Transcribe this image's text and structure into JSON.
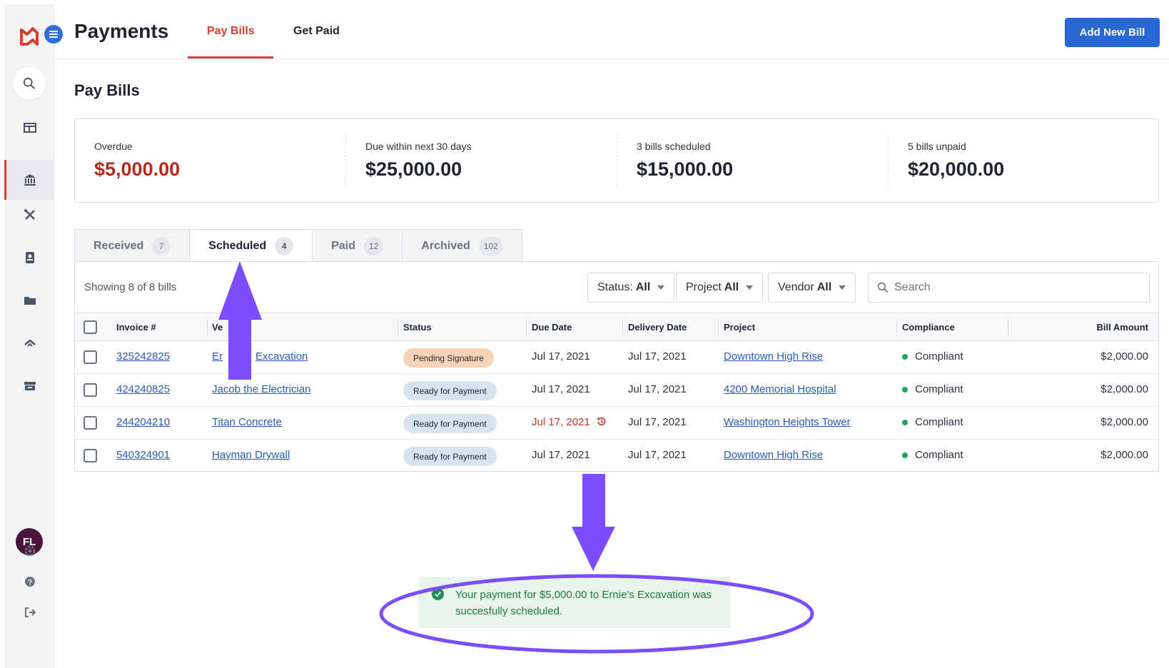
{
  "app": {
    "title": "Payments",
    "tabs": [
      "Pay Bills",
      "Get Paid"
    ],
    "add_button": "Add New Bill"
  },
  "sidebar": {
    "avatar_initials": "FL",
    "icons": [
      "search-icon",
      "dashboard-icon",
      "bank-icon",
      "tools-icon",
      "contacts-icon",
      "folder-icon",
      "handshake-icon",
      "archive-icon",
      "gear-icon",
      "help-icon",
      "logout-icon"
    ]
  },
  "page": {
    "heading": "Pay Bills"
  },
  "summary": [
    {
      "label": "Overdue",
      "value": "$5,000.00"
    },
    {
      "label": "Due within next 30 days",
      "value": "$25,000.00"
    },
    {
      "label": "3 bills scheduled",
      "value": "$15,000.00"
    },
    {
      "label": "5 bills unpaid",
      "value": "$20,000.00"
    }
  ],
  "bill_tabs": [
    {
      "label": "Received",
      "count": "7"
    },
    {
      "label": "Scheduled",
      "count": "4"
    },
    {
      "label": "Paid",
      "count": "12"
    },
    {
      "label": "Archived",
      "count": "102"
    }
  ],
  "filters": {
    "showing": "Showing 8 of 8 bills",
    "status": {
      "label": "Status:",
      "value": "All"
    },
    "project": {
      "label": "Project",
      "value": "All"
    },
    "vendor": {
      "label": "Vendor",
      "value": "All"
    },
    "search_placeholder": "Search"
  },
  "table": {
    "columns": [
      "Invoice #",
      "Ve",
      "Status",
      "Due Date",
      "Delivery Date",
      "Project",
      "Compliance",
      "Bill Amount"
    ],
    "rows": [
      {
        "invoice": "325242825",
        "vendor": "Er",
        "vendor_rest": "Excavation",
        "status": "Pending Signature",
        "due": "Jul 17, 2021",
        "delivery": "Jul 17, 2021",
        "project": "Downtown High Rise",
        "compliance": "Compliant",
        "amount": "$2,000.00"
      },
      {
        "invoice": "424240825",
        "vendor": "Jacob the Electrician",
        "vendor_rest": "",
        "status": "Ready for Payment",
        "due": "Jul 17, 2021",
        "delivery": "Jul 17, 2021",
        "project": "4200 Memorial Hospital",
        "compliance": "Compliant",
        "amount": "$2,000.00"
      },
      {
        "invoice": "244204210",
        "vendor": "Titan Concrete",
        "vendor_rest": "",
        "status": "Ready for Payment",
        "due": "Jul 17, 2021",
        "delivery": "Jul 17, 2021",
        "project": "Washington Heights Tower",
        "compliance": "Compliant",
        "amount": "$2,000.00"
      },
      {
        "invoice": "540324901",
        "vendor": "Hayman Drywall",
        "vendor_rest": "",
        "status": "Ready for Payment",
        "due": "Jul 17, 2021",
        "delivery": "Jul 17, 2021",
        "project": "Downtown High Rise",
        "compliance": "Compliant",
        "amount": "$2,000.00"
      }
    ]
  },
  "toast": {
    "message": "Your payment for $5,000.00 to Ernie's Excavation was succesfully scheduled."
  },
  "colors": {
    "brand": "#d6402e",
    "primary": "#2a67d6",
    "overdue": "#b52a1c",
    "annotation": "#7b4dff"
  }
}
